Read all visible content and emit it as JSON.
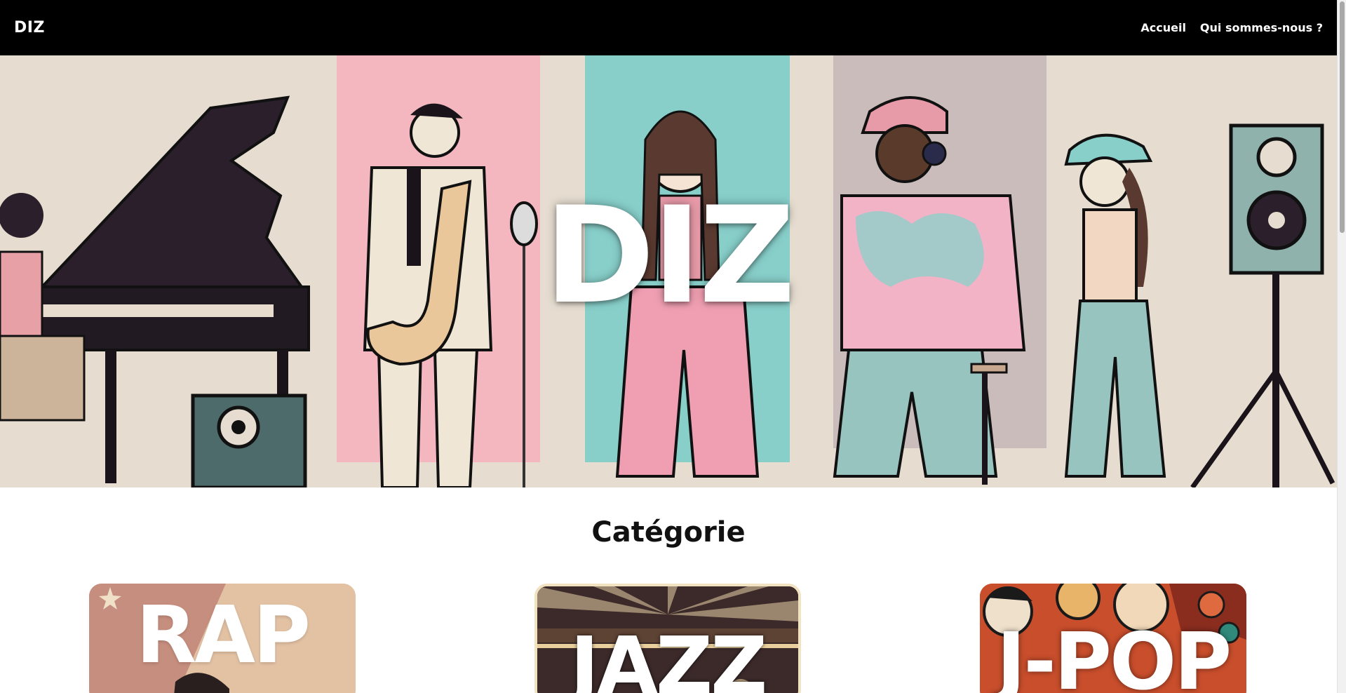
{
  "navbar": {
    "brand": "DIZ",
    "links": [
      "Accueil",
      "Qui sommes-nous ?"
    ]
  },
  "hero": {
    "title": "DIZ"
  },
  "category": {
    "title": "Catégorie",
    "cards": [
      {
        "label": "RAP"
      },
      {
        "label": "JAZZ"
      },
      {
        "label": "J-POP"
      }
    ]
  },
  "colors": {
    "navbar_bg": "#000000",
    "hero_beige": "#e6ddd0",
    "hero_pink": "#f4b7c0",
    "hero_teal": "#88cfca",
    "hero_mauve": "#cbbcbc",
    "text_dark": "#111111"
  }
}
